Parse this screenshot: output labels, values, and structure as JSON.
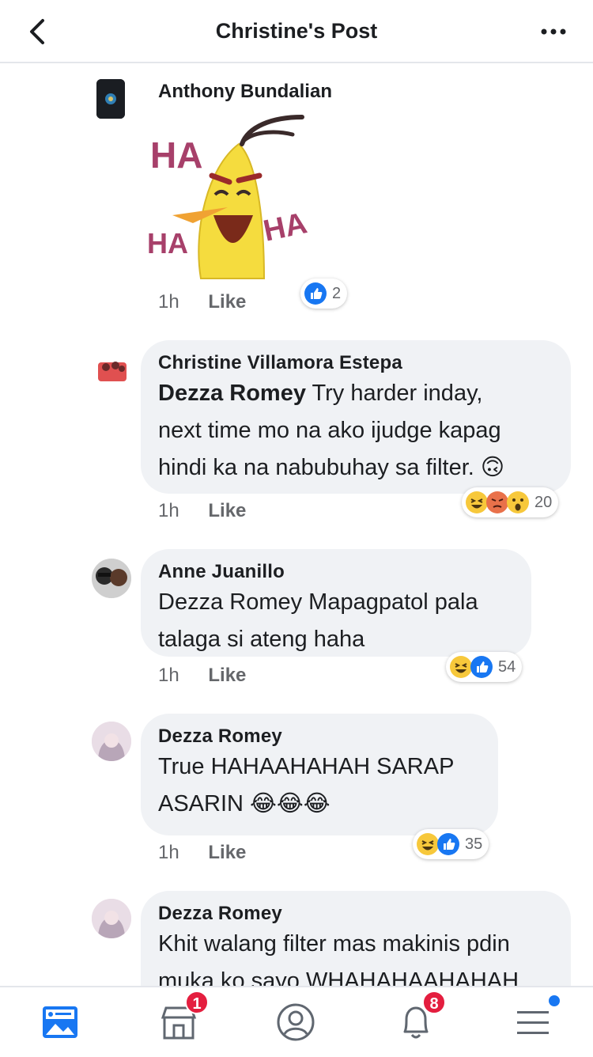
{
  "header": {
    "title": "Christine's Post"
  },
  "comments": [
    {
      "author": "Anthony Bundalian",
      "sticker_text": [
        "HA",
        "HA",
        "HA"
      ],
      "time": "1h",
      "like_label": "Like",
      "reaction_count": "2"
    },
    {
      "author": "Christine Villamora Estepa",
      "mention": "Dezza Romey",
      "lines": [
        " Try harder inday,",
        "next time mo na ako ijudge kapag",
        "hindi ka na nabubuhay sa filter. 🙃"
      ],
      "time": "1h",
      "like_label": "Like",
      "reaction_count": "20"
    },
    {
      "author": "Anne Juanillo",
      "lines": [
        "Dezza Romey Mapagpatol pala",
        "talaga si ateng haha"
      ],
      "time": "1h",
      "like_label": "Like",
      "reaction_count": "54"
    },
    {
      "author": "Dezza Romey",
      "lines": [
        "True HAHAAHAHAH SARAP",
        "ASARIN 😂😂😂"
      ],
      "time": "1h",
      "like_label": "Like",
      "reaction_count": "35"
    },
    {
      "author": "Dezza Romey",
      "lines": [
        "Khit walang filter mas makinis pdin",
        "muka ko sayo WHAHAHAAHAHAH"
      ]
    }
  ],
  "bottom_nav": {
    "marketplace_badge": "1",
    "notifications_badge": "8"
  },
  "colors": {
    "like_blue": "#1877f2",
    "badge_red": "#e41e3f",
    "bubble_gray": "#f0f2f5"
  }
}
